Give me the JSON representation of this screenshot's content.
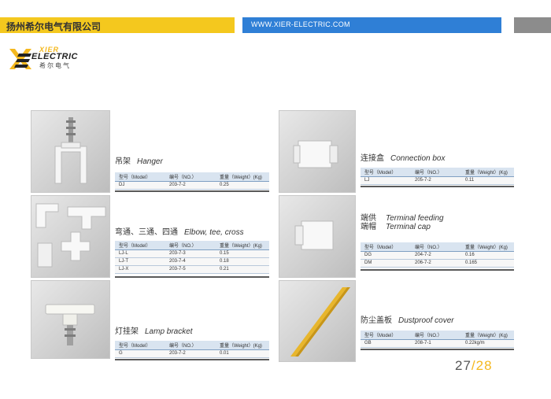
{
  "header": {
    "company": "扬州希尔电气有限公司",
    "website": "WWW.XIER-ELECTRIC.COM"
  },
  "logo": {
    "brand_top": "XIER",
    "brand_main": "ELECTRIC",
    "brand_cn": "希尔电气"
  },
  "products": {
    "hanger": {
      "title_cn": "吊架",
      "title_en": "Hanger",
      "headers": [
        "型号（Model）",
        "编号（NO.）",
        "重量（Weight）(Kg)"
      ],
      "rows": [
        [
          "DJ",
          "203-7-2",
          "0.25"
        ]
      ]
    },
    "elbow": {
      "title_cn": "弯通、三通、四通",
      "title_en": "Elbow, tee, cross",
      "headers": [
        "型号（Model）",
        "编号（NO.）",
        "重量（Weight）(Kg)"
      ],
      "rows": [
        [
          "LJ-L",
          "203-7-3",
          "0.15"
        ],
        [
          "LJ-T",
          "203-7-4",
          "0.18"
        ],
        [
          "LJ-X",
          "203-7-5",
          "0.21"
        ]
      ]
    },
    "lamp": {
      "title_cn": "灯挂架",
      "title_en": "Lamp bracket",
      "headers": [
        "型号（Model）",
        "编号（NO.）",
        "重量（Weight）(Kg)"
      ],
      "rows": [
        [
          "G",
          "203-7-2",
          "0.01"
        ]
      ]
    },
    "connection": {
      "title_cn": "连接盒",
      "title_en": "Connection box",
      "headers": [
        "型号（Model）",
        "编号（NO.）",
        "重量（Weight）(Kg)"
      ],
      "rows": [
        [
          "LJ",
          "205-7-2",
          "0.11"
        ]
      ]
    },
    "terminal": {
      "title_cn_1": "端供",
      "title_cn_2": "端帽",
      "title_en_1": "Terminal feeding",
      "title_en_2": "Terminal cap",
      "headers": [
        "型号（Model）",
        "编号（NO.）",
        "重量（Weight）(Kg)"
      ],
      "rows": [
        [
          "DG",
          "204-7-2",
          "0.16"
        ],
        [
          "DM",
          "206-7-2",
          "0.165"
        ]
      ]
    },
    "dustproof": {
      "title_cn": "防尘盖板",
      "title_en": "Dustproof cover",
      "headers": [
        "型号（Model）",
        "编号（NO.）",
        "重量（Weight）(Kg)"
      ],
      "rows": [
        [
          "GB",
          "208-7-1",
          "0.22kg/m"
        ]
      ]
    }
  },
  "page": {
    "current": "27",
    "separator": "/",
    "total": "28"
  },
  "colors": {
    "accent_yellow": "#f4c81e",
    "accent_blue": "#2f7fd6",
    "header_gray": "#8c8c8c"
  }
}
